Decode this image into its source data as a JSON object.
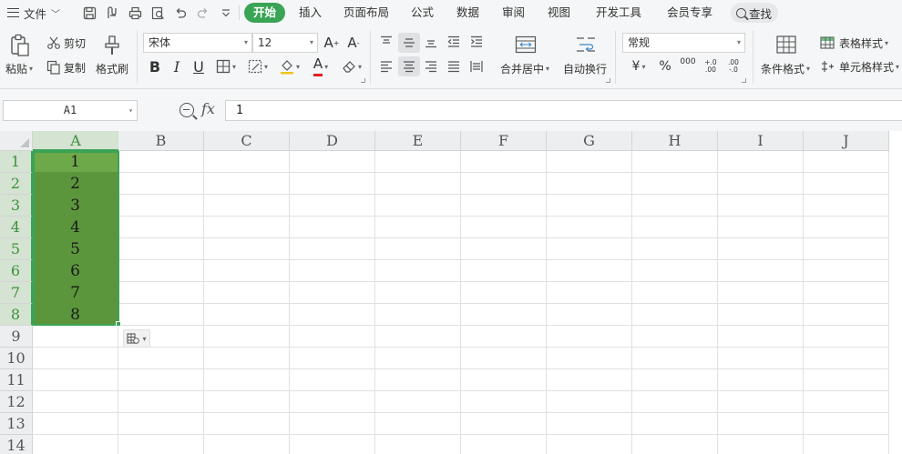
{
  "menubar": {
    "file": "文件",
    "tabs": [
      {
        "label": "开始",
        "active": true
      },
      {
        "label": "插入"
      },
      {
        "label": "页面布局"
      },
      {
        "label": "公式"
      },
      {
        "label": "数据"
      },
      {
        "label": "审阅"
      },
      {
        "label": "视图"
      },
      {
        "label": "开发工具"
      },
      {
        "label": "会员专享"
      }
    ],
    "search": "查找",
    "quick_access_icons": [
      "save-icon",
      "export-pdf-icon",
      "print-icon",
      "print-preview-icon",
      "undo-icon",
      "redo-icon",
      "customize-dropdown-icon"
    ]
  },
  "ribbon": {
    "clipboard": {
      "paste": "粘贴",
      "cut": "剪切",
      "copy": "复制",
      "format_painter": "格式刷"
    },
    "font": {
      "name": "宋体",
      "size": "12",
      "bold": "B",
      "italic": "I",
      "underline": "U",
      "font_color_letter": "A",
      "font_color": "#e02020"
    },
    "alignment": {
      "merge_center": "合并居中",
      "wrap_text": "自动换行"
    },
    "number": {
      "format": "常规",
      "currency": "¥",
      "percent": "%",
      "thousands": "000",
      "inc_decimal": "+.0 .00",
      "dec_decimal": ".00 -.0"
    },
    "styles": {
      "conditional": "条件格式",
      "table_style": "表格样式",
      "cell_style": "单元格样式"
    }
  },
  "formula_bar": {
    "name_box": "A1",
    "fx": "fx",
    "value": "1"
  },
  "grid": {
    "columns": [
      "A",
      "B",
      "C",
      "D",
      "E",
      "F",
      "G",
      "H",
      "I",
      "J"
    ],
    "rows": [
      "1",
      "2",
      "3",
      "4",
      "5",
      "6",
      "7",
      "8",
      "9",
      "10",
      "11",
      "12",
      "13",
      "14"
    ],
    "column_a_values": [
      "1",
      "2",
      "3",
      "4",
      "5",
      "6",
      "7",
      "8"
    ],
    "selection": "A1:A8",
    "accent_color": "#3aa456",
    "selection_fill": "#5c963c"
  }
}
